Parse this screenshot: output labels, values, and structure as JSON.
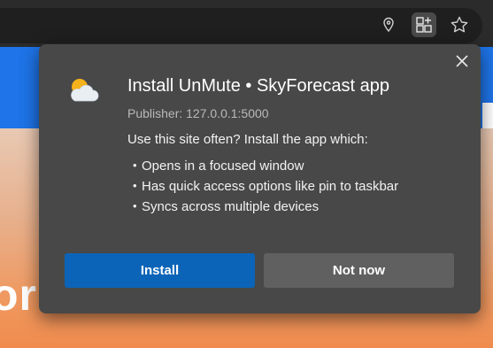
{
  "browser": {
    "toolbar_icons": [
      "location-icon",
      "app-available-icon",
      "favorites-star-icon"
    ]
  },
  "background_page": {
    "hero_text": "ore"
  },
  "popup": {
    "title": "Install UnMute • SkyForecast app",
    "publisher": "Publisher: 127.0.0.1:5000",
    "question": "Use this site often? Install the app which:",
    "features": [
      "Opens in a focused window",
      "Has quick access options like pin to taskbar",
      "Syncs across multiple devices"
    ],
    "install_label": "Install",
    "not_now_label": "Not now",
    "icon": "partly-cloudy-icon"
  },
  "colors": {
    "popup_bg": "#484848",
    "install_button": "#0c64b8",
    "not_now_button": "#606060",
    "page_header_blue": "#1e74e8"
  }
}
